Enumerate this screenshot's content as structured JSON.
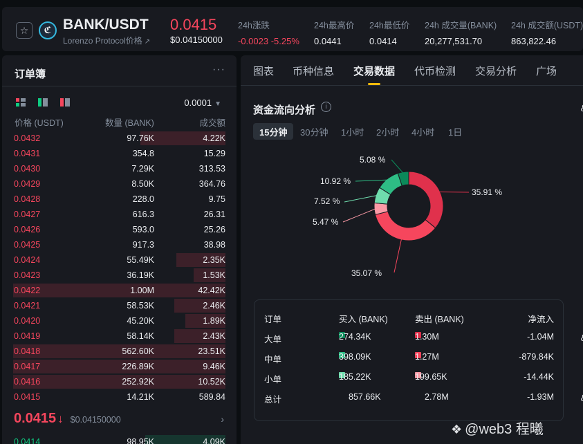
{
  "ticker": {
    "pair": "BANK/USDT",
    "sub": "Lorenzo Protocol价格",
    "price": "0.0415",
    "price_usd": "$0.04150000",
    "stats": [
      {
        "label": "24h涨跌",
        "value": "-0.0023 -5.25%",
        "color": "red"
      },
      {
        "label": "24h最高价",
        "value": "0.0441",
        "color": "white"
      },
      {
        "label": "24h最低价",
        "value": "0.0414",
        "color": "white"
      },
      {
        "label": "24h 成交量(BANK)",
        "value": "20,277,531.70",
        "color": "white"
      },
      {
        "label": "24h 成交额(USDT)",
        "value": "863,822.46",
        "color": "white"
      }
    ]
  },
  "orderbook": {
    "title": "订单簿",
    "precision": "0.0001",
    "headers": {
      "price": "价格 (USDT)",
      "qty": "数量 (BANK)",
      "total": "成交额"
    },
    "asks": [
      {
        "price": "0.0432",
        "qty": "97.76K",
        "total": "4.22K",
        "depth": 0.4
      },
      {
        "price": "0.0431",
        "qty": "354.8",
        "total": "15.29",
        "depth": 0.0
      },
      {
        "price": "0.0430",
        "qty": "7.29K",
        "total": "313.53",
        "depth": 0.0
      },
      {
        "price": "0.0429",
        "qty": "8.50K",
        "total": "364.76",
        "depth": 0.0
      },
      {
        "price": "0.0428",
        "qty": "228.0",
        "total": "9.75",
        "depth": 0.0
      },
      {
        "price": "0.0427",
        "qty": "616.3",
        "total": "26.31",
        "depth": 0.0
      },
      {
        "price": "0.0426",
        "qty": "593.0",
        "total": "25.26",
        "depth": 0.0
      },
      {
        "price": "0.0425",
        "qty": "917.3",
        "total": "38.98",
        "depth": 0.0
      },
      {
        "price": "0.0424",
        "qty": "55.49K",
        "total": "2.35K",
        "depth": 0.23
      },
      {
        "price": "0.0423",
        "qty": "36.19K",
        "total": "1.53K",
        "depth": 0.15
      },
      {
        "price": "0.0422",
        "qty": "1.00M",
        "total": "42.42K",
        "depth": 1.0
      },
      {
        "price": "0.0421",
        "qty": "58.53K",
        "total": "2.46K",
        "depth": 0.24
      },
      {
        "price": "0.0420",
        "qty": "45.20K",
        "total": "1.89K",
        "depth": 0.19
      },
      {
        "price": "0.0419",
        "qty": "58.14K",
        "total": "2.43K",
        "depth": 0.24
      },
      {
        "price": "0.0418",
        "qty": "562.60K",
        "total": "23.51K",
        "depth": 1.0
      },
      {
        "price": "0.0417",
        "qty": "226.89K",
        "total": "9.46K",
        "depth": 1.0
      },
      {
        "price": "0.0416",
        "qty": "252.92K",
        "total": "10.52K",
        "depth": 1.0
      },
      {
        "price": "0.0415",
        "qty": "14.21K",
        "total": "589.84",
        "depth": 0.0
      }
    ],
    "last_price": "0.0415",
    "last_price_arrow": "↓",
    "last_price_usd": "$0.04150000",
    "bid": {
      "price": "0.0414",
      "qty": "98.95K",
      "total": "4.09K",
      "depth": 0.36
    }
  },
  "tabs": [
    "图表",
    "币种信息",
    "交易数据",
    "代币检测",
    "交易分析",
    "广场"
  ],
  "active_tab": "交易数据",
  "fund_flow": {
    "title": "资金流向分析",
    "ranges": [
      "15分钟",
      "30分钟",
      "1小时",
      "2小时",
      "4小时",
      "1日"
    ],
    "active_range": "15分钟",
    "colors": {
      "buy_large": "#0b8a5a",
      "buy_mid": "#2ebd85",
      "buy_small": "#6fdcad",
      "sell_large": "#e0314c",
      "sell_mid": "#f6465d",
      "sell_small": "#fb9aa6"
    },
    "chart_data": {
      "type": "pie",
      "slices": [
        {
          "label": "35.91 %",
          "value": 35.91,
          "color": "#e0314c"
        },
        {
          "label": "35.07 %",
          "value": 35.07,
          "color": "#f6465d"
        },
        {
          "label": "5.47 %",
          "value": 5.47,
          "color": "#fb9aa6"
        },
        {
          "label": "7.52 %",
          "value": 7.52,
          "color": "#6fdcad"
        },
        {
          "label": "10.92 %",
          "value": 10.92,
          "color": "#2ebd85"
        },
        {
          "label": "5.08 %",
          "value": 5.08,
          "color": "#0b8a5a"
        }
      ]
    },
    "table": {
      "headers": [
        "订单",
        "买入 (BANK)",
        "卖出 (BANK)",
        "净流入"
      ],
      "rows": [
        {
          "name": "大单",
          "buy": "274.34K",
          "sell": "1.30M",
          "net": "-1.04M",
          "buy_color": "#0b8a5a",
          "sell_color": "#e0314c"
        },
        {
          "name": "中单",
          "buy": "398.09K",
          "sell": "1.27M",
          "net": "-879.84K",
          "buy_color": "#2ebd85",
          "sell_color": "#f6465d"
        },
        {
          "name": "小单",
          "buy": "185.22K",
          "sell": "199.65K",
          "net": "-14.44K",
          "buy_color": "#6fdcad",
          "sell_color": "#fb9aa6"
        },
        {
          "name": "总计",
          "buy": "857.66K",
          "sell": "2.78M",
          "net": "-1.93M"
        }
      ]
    }
  },
  "edge_chars": [
    "&",
    "&",
    "&"
  ],
  "watermark": "@web3 程曦"
}
